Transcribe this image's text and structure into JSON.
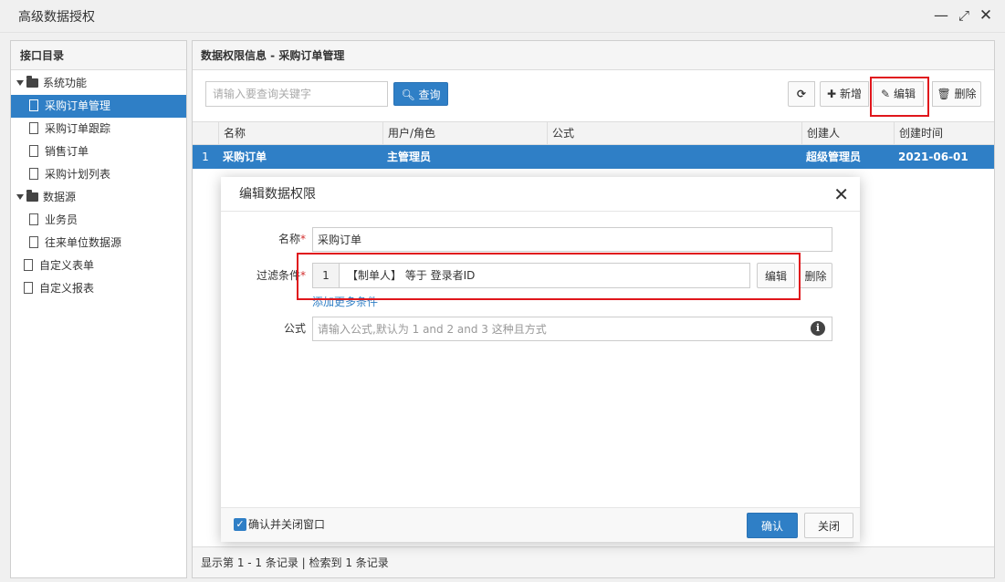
{
  "window": {
    "title": "高级数据授权",
    "minimize_icon": "minimize-icon",
    "maximize_icon": "maximize-icon",
    "close_icon": "close-icon"
  },
  "left_panel": {
    "title": "接口目录",
    "tree": [
      {
        "label": "系统功能",
        "type": "folder",
        "children": [
          "采购订单管理",
          "采购订单跟踪",
          "销售订单",
          "采购计划列表"
        ]
      },
      {
        "label": "数据源",
        "type": "folder",
        "children": [
          "业务员",
          "往来单位数据源"
        ]
      },
      {
        "label": "自定义表单",
        "type": "page"
      },
      {
        "label": "自定义报表",
        "type": "page"
      }
    ],
    "selected": "采购订单管理"
  },
  "right_panel": {
    "title": "数据权限信息 - 采购订单管理",
    "search": {
      "placeholder": "请输入要查询关键字",
      "value": ""
    },
    "query_label": "查询",
    "toolbar": {
      "add_label": "新增",
      "edit_label": "编辑",
      "delete_label": "删除"
    },
    "table": {
      "columns": [
        "名称",
        "用户/角色",
        "公式",
        "创建人",
        "创建时间"
      ],
      "rows": [
        {
          "index": "1",
          "name": "采购订单",
          "user_role": "主管理员",
          "formula": "",
          "creator": "超级管理员",
          "created": "2021-06-01"
        }
      ]
    },
    "status": "显示第 1 - 1 条记录 | 检索到 1 条记录"
  },
  "modal": {
    "title": "编辑数据权限",
    "name_label": "名称",
    "name_value": "采购订单",
    "filter_label": "过滤条件",
    "condition": {
      "index": "1",
      "text": "【制单人】 等于 登录者ID"
    },
    "edit_label": "编辑",
    "delete_label": "删除",
    "add_more_label": "添加更多条件",
    "formula_label": "公式",
    "formula_placeholder": "请输入公式,默认为 1 and 2 and 3 这种且方式",
    "confirm_close_label": "确认并关闭窗口",
    "confirm_close_checked": true,
    "ok_label": "确认",
    "close_label": "关闭"
  },
  "colors": {
    "accent": "#2f7fc6",
    "highlight": "#e0161c",
    "required": "#d32f2f"
  }
}
